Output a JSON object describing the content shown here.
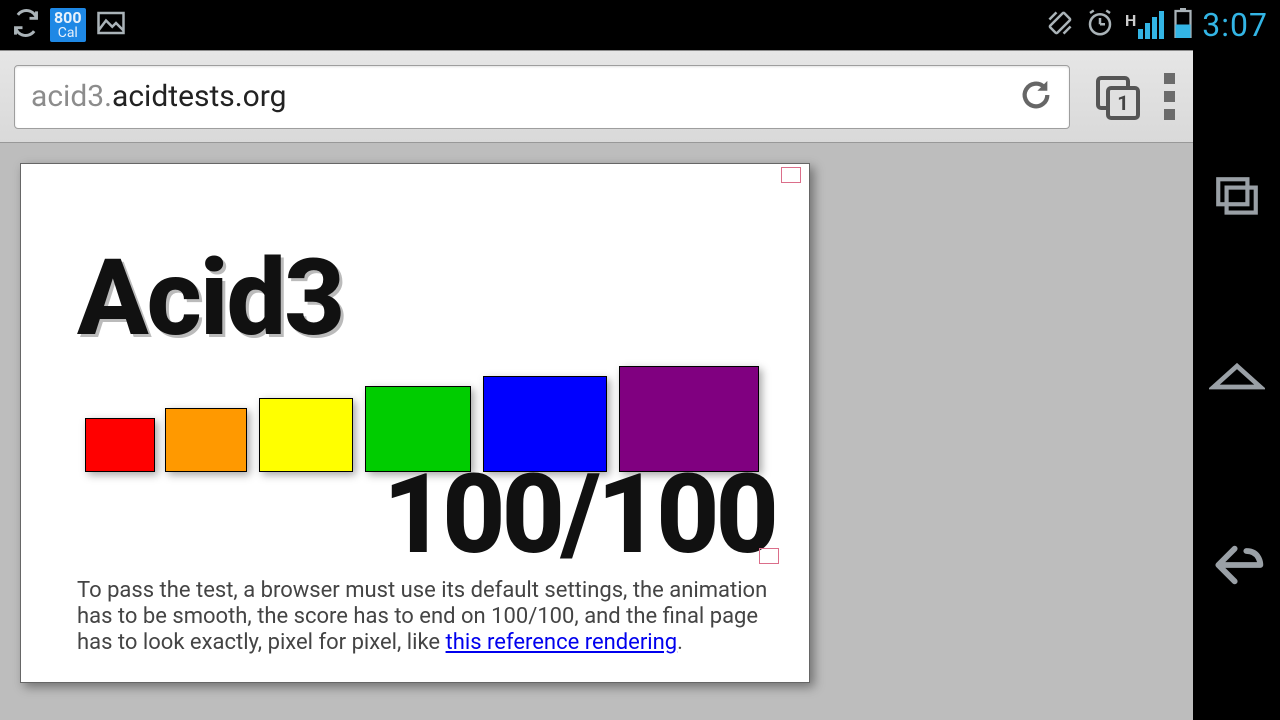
{
  "status": {
    "cal_num": "800",
    "cal_label": "Cal",
    "network_letter": "H",
    "clock": "3:07"
  },
  "browser": {
    "url_subdomain": "acid3.",
    "url_domain": "acidtests.org",
    "tab_count": "1"
  },
  "acid3": {
    "title": "Acid3",
    "score": "100/100",
    "boxes": [
      {
        "color": "#ff0000"
      },
      {
        "color": "#ff9900"
      },
      {
        "color": "#ffff00"
      },
      {
        "color": "#00cc00"
      },
      {
        "color": "#0000ff"
      },
      {
        "color": "#800080"
      }
    ],
    "desc1": "To pass the test, a browser must use its default settings, the animation has to be smooth, the score has to end on 100/100, and the final page has to look exactly, pixel for pixel, like ",
    "link": "this reference rendering",
    "desc2": "."
  }
}
